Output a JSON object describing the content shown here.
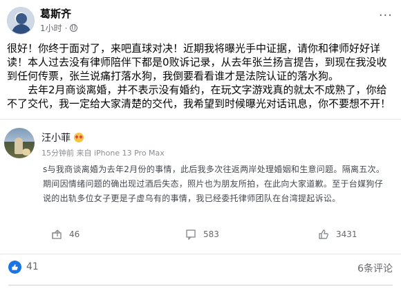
{
  "post": {
    "author": "葛斯齐",
    "time": "1小时",
    "dot": "·",
    "paragraphs": [
      "很好！你终于面对了，来吧直球对决！近期我将曝光手中证据，请你和律师好好详读！本人过去没有律师陪伴下都是0败诉记录，从去年张兰扬言提告，到现在我没收到任何传票，张兰说痛打落水狗，我倒要看看谁才是法院认证的落水狗。",
      "去年2月商谈离婚，并不表示没有婚约，在玩文字游戏真的就太不成熟了，你给不了交代，我一定给大家清楚的交代，我希望到时候曝光对话讯息，你不要想不开！"
    ]
  },
  "embed": {
    "author": "汪小菲",
    "meta": "15分钟前  来自 iPhone 13 Pro Max",
    "text": "s与我商谈离婚为去年2月份的事情，此后我多次往返两岸处理婚姻和生意问题。隔离五次。期间因情绪问题的确出现过酒后失态，照片也为朋友所拍，在此向大家道歉。至于台媒狗仔说的出轨多位女子更是子虚乌有的事情，我已经委托律师团队在台湾提起诉讼。",
    "actions": {
      "share_count": "46",
      "comment_count": "583",
      "like_count": "3431"
    }
  },
  "footer": {
    "like_count": "41",
    "comment_count": "6条评论"
  },
  "colors": {
    "accent": "#1b74e4",
    "muted": "#65676b"
  }
}
